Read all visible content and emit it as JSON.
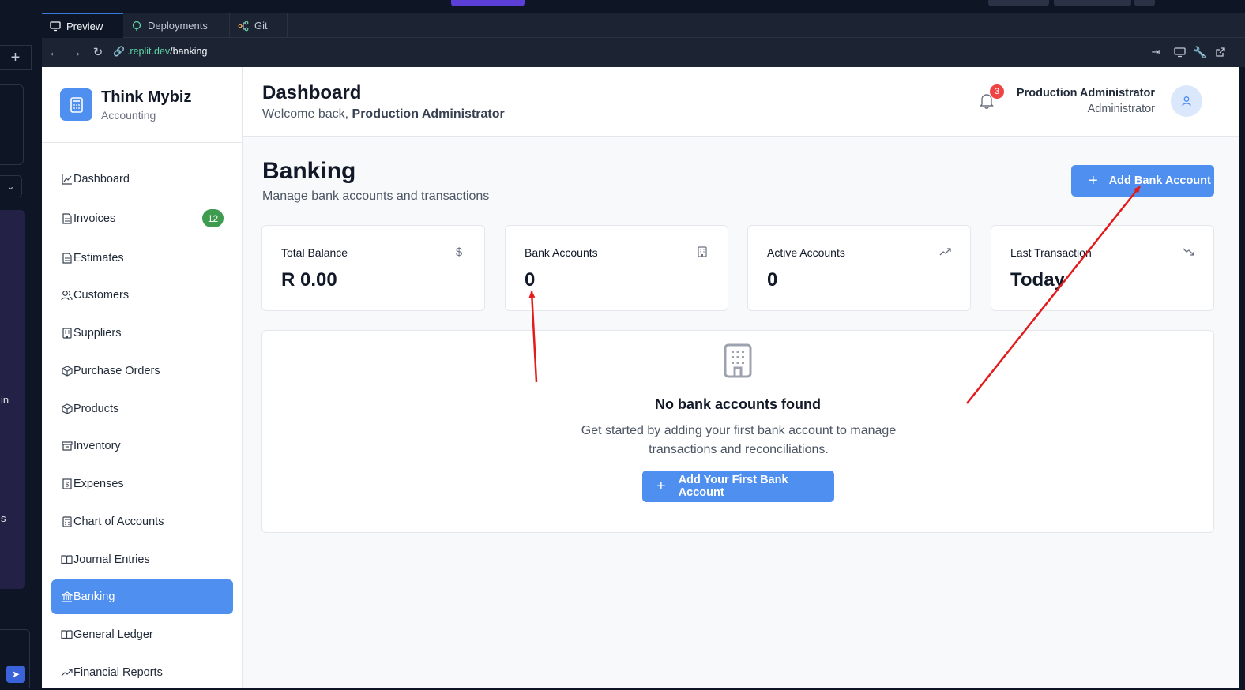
{
  "replit": {
    "tabs": [
      {
        "label": "Preview",
        "icon": "monitor-icon"
      },
      {
        "label": "Deployments",
        "icon": "deploy-icon"
      },
      {
        "label": "Git",
        "icon": "git-icon"
      }
    ],
    "url": {
      "host": ".replit.dev",
      "path": "/banking"
    },
    "left_panel_texts": {
      "a": "in",
      "b": "s"
    }
  },
  "brand": {
    "name": "Think Mybiz",
    "subtitle": "Accounting"
  },
  "sidebar": {
    "items": [
      {
        "label": "Dashboard",
        "icon": "chart-line-icon"
      },
      {
        "label": "Invoices",
        "icon": "file-icon",
        "badge": "12"
      },
      {
        "label": "Estimates",
        "icon": "file-icon"
      },
      {
        "label": "Customers",
        "icon": "users-icon"
      },
      {
        "label": "Suppliers",
        "icon": "building-icon"
      },
      {
        "label": "Purchase Orders",
        "icon": "package-icon"
      },
      {
        "label": "Products",
        "icon": "package-icon"
      },
      {
        "label": "Inventory",
        "icon": "archive-icon"
      },
      {
        "label": "Expenses",
        "icon": "receipt-icon"
      },
      {
        "label": "Chart of Accounts",
        "icon": "calculator-icon"
      },
      {
        "label": "Journal Entries",
        "icon": "book-icon"
      },
      {
        "label": "Banking",
        "icon": "bank-icon",
        "active": true
      },
      {
        "label": "General Ledger",
        "icon": "book-open-icon"
      },
      {
        "label": "Financial Reports",
        "icon": "trending-icon"
      }
    ]
  },
  "header": {
    "title": "Dashboard",
    "welcome_prefix": "Welcome back, ",
    "welcome_name": "Production Administrator",
    "notifications": "3",
    "user_name": "Production Administrator",
    "user_role": "Administrator"
  },
  "page": {
    "title": "Banking",
    "subtitle": "Manage bank accounts and transactions",
    "add_button": "Add Bank Account"
  },
  "cards": [
    {
      "label": "Total Balance",
      "value": "R 0.00",
      "icon": "dollar-icon"
    },
    {
      "label": "Bank Accounts",
      "value": "0",
      "icon": "building-icon"
    },
    {
      "label": "Active Accounts",
      "value": "0",
      "icon": "trending-up-icon"
    },
    {
      "label": "Last Transaction",
      "value": "Today",
      "icon": "trending-down-icon"
    }
  ],
  "empty": {
    "title": "No bank accounts found",
    "description": "Get started by adding your first bank account to manage transactions and reconciliations.",
    "button": "Add Your First Bank Account"
  },
  "colors": {
    "primary": "#4f8fef",
    "badge_green": "#3f9b4f",
    "badge_red": "#ef4444",
    "annotation": "#e31b1b"
  }
}
